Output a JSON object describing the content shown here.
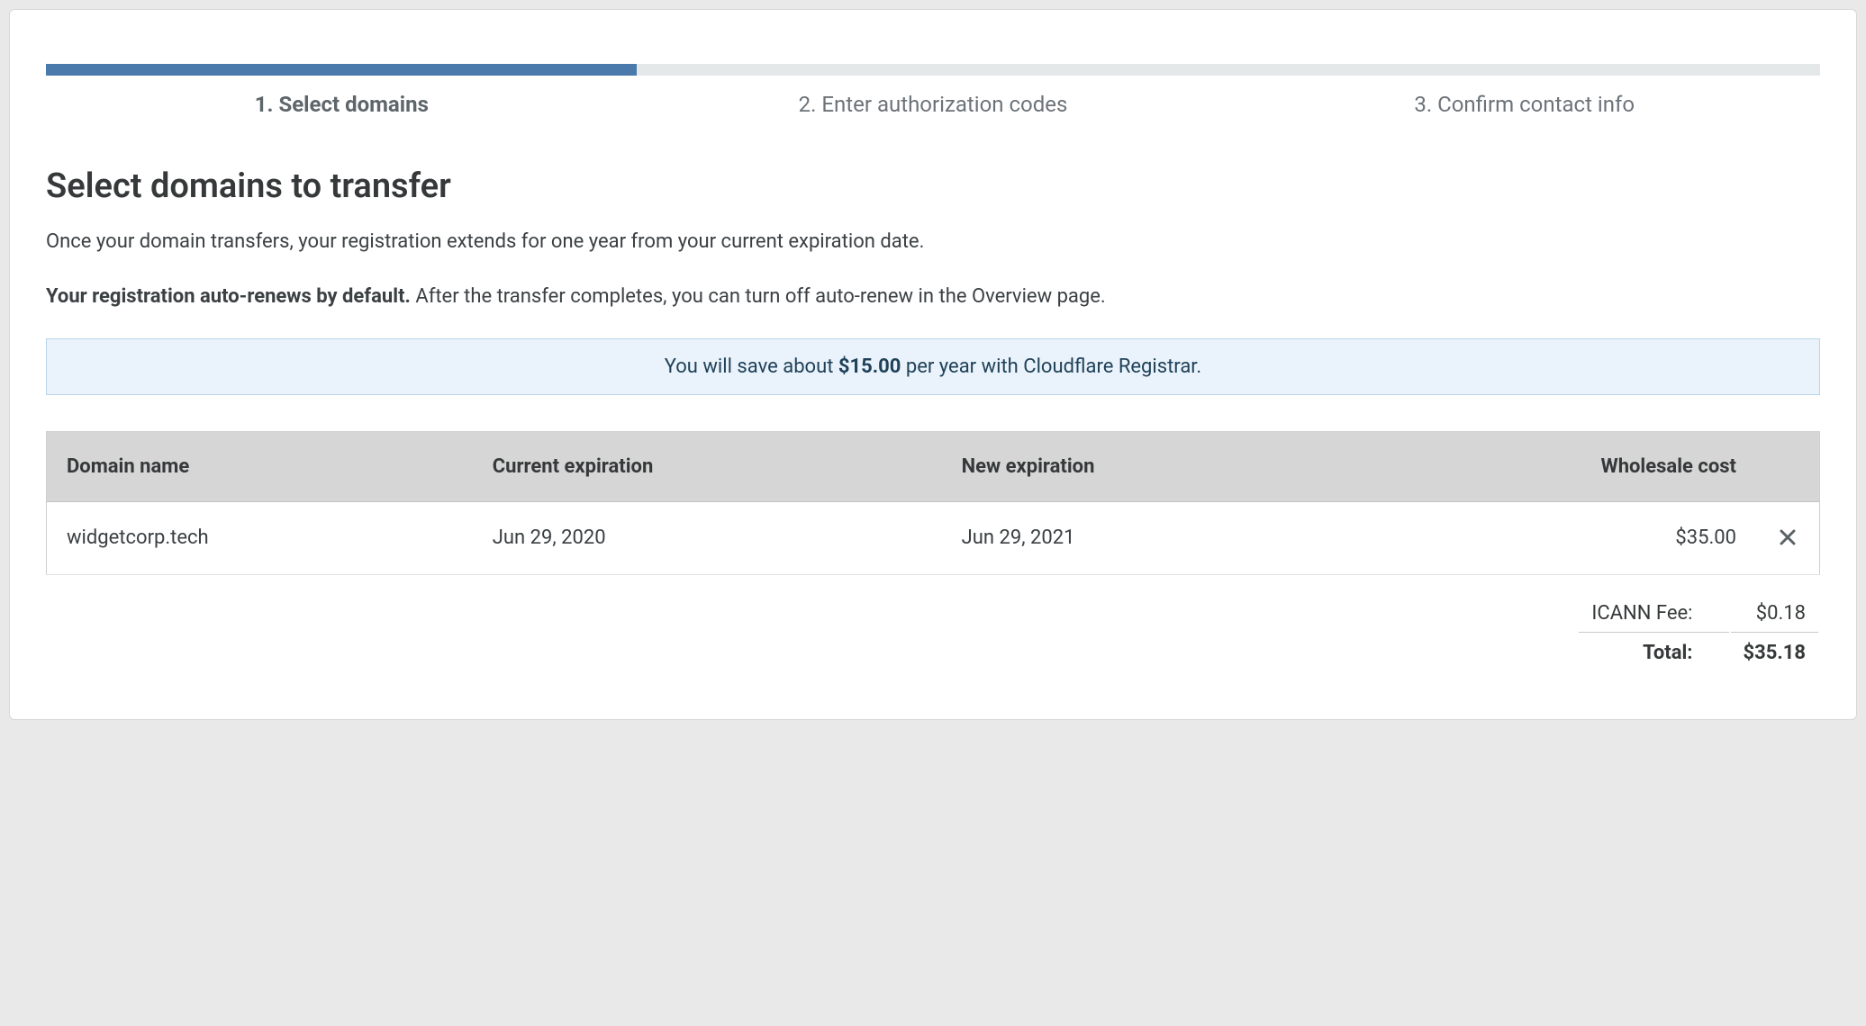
{
  "progress": {
    "percent": 33.3
  },
  "steps": [
    {
      "label": "1. Select domains",
      "active": true
    },
    {
      "label": "2. Enter authorization codes",
      "active": false
    },
    {
      "label": "3. Confirm contact info",
      "active": false
    }
  ],
  "title": "Select domains to transfer",
  "lead1": "Once your domain transfers, your registration extends for one year from your current expiration date.",
  "lead2_bold": "Your registration auto-renews by default.",
  "lead2_rest": " After the transfer completes, you can turn off auto-renew in the Overview page.",
  "banner": {
    "pre": "You will save about ",
    "amount": "$15.00",
    "post": " per year with Cloudflare Registrar."
  },
  "table": {
    "headers": {
      "domain": "Domain name",
      "current": "Current expiration",
      "new": "New expiration",
      "cost": "Wholesale cost"
    },
    "rows": [
      {
        "domain": "widgetcorp.tech",
        "current": "Jun 29, 2020",
        "new": "Jun 29, 2021",
        "cost": "$35.00"
      }
    ]
  },
  "totals": {
    "icann_label": "ICANN Fee:",
    "icann_value": "$0.18",
    "total_label": "Total:",
    "total_value": "$35.18"
  }
}
